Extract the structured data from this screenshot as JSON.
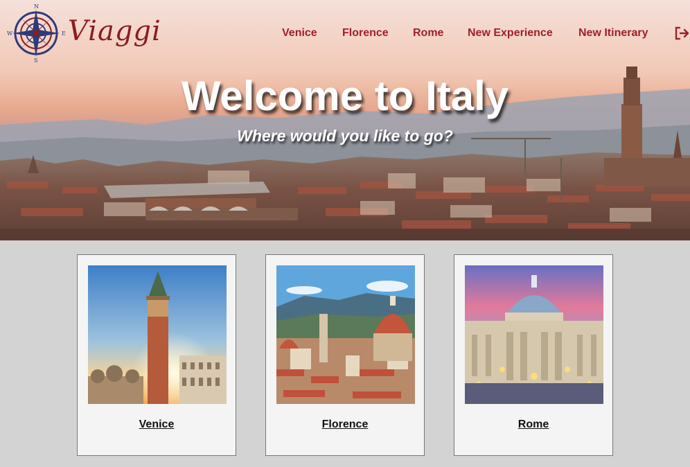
{
  "app": {
    "brand": "Viaggi"
  },
  "nav": {
    "items": [
      {
        "label": "Venice"
      },
      {
        "label": "Florence"
      },
      {
        "label": "Rome"
      },
      {
        "label": "New Experience"
      },
      {
        "label": "New Itinerary"
      }
    ],
    "logout_icon": "logout-arrow-icon"
  },
  "logo": {
    "icon": "compass-rose-icon",
    "letters": {
      "n": "N",
      "s": "S",
      "e": "E",
      "w": "W"
    }
  },
  "hero": {
    "title": "Welcome to Italy",
    "subtitle": "Where would you like to go?"
  },
  "cities": [
    {
      "name": "Venice",
      "image": "venice-campanile-photo"
    },
    {
      "name": "Florence",
      "image": "florence-duomo-photo"
    },
    {
      "name": "Rome",
      "image": "rome-st-peters-photo"
    }
  ],
  "colors": {
    "accent": "#a0202a",
    "brand": "#8b1d20",
    "page_bg": "#d3d3d3",
    "card_bg": "#f4f4f4"
  }
}
